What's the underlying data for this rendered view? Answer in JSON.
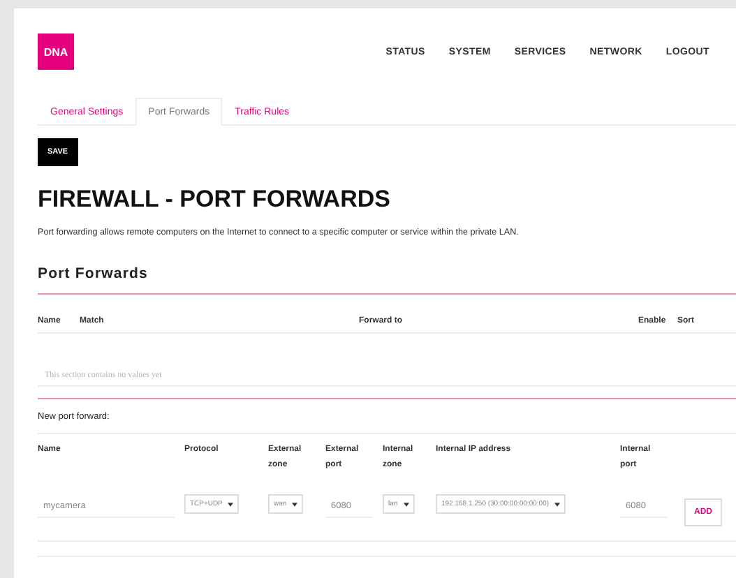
{
  "logo": "DNA",
  "nav": [
    "STATUS",
    "SYSTEM",
    "SERVICES",
    "NETWORK",
    "LOGOUT"
  ],
  "tabs": [
    {
      "label": "General Settings",
      "selected": false
    },
    {
      "label": "Port Forwards",
      "selected": true
    },
    {
      "label": "Traffic Rules",
      "selected": false
    }
  ],
  "save_button": "SAVE",
  "title": "FIREWALL - PORT FORWARDS",
  "description": "Port forwarding allows remote computers on the Internet to connect to a specific computer or service within the private LAN.",
  "section_title": "Port Forwards",
  "table": {
    "columns": [
      "Name",
      "Match",
      "Forward to",
      "Enable",
      "Sort"
    ],
    "empty_message": "This section contains no values yet"
  },
  "new_forward": {
    "label": "New port forward:",
    "columns": [
      [
        "Name"
      ],
      [
        "Protocol"
      ],
      [
        "External",
        "zone"
      ],
      [
        "External",
        "port"
      ],
      [
        "Internal",
        "zone"
      ],
      [
        "Internal IP address"
      ],
      [
        "Internal",
        "port"
      ]
    ],
    "fields": [
      {
        "kind": "text",
        "value": "mycamera"
      },
      {
        "kind": "select",
        "value": "TCP+UDP"
      },
      {
        "kind": "select",
        "value": "wan"
      },
      {
        "kind": "text",
        "value": "6080"
      },
      {
        "kind": "select",
        "value": "lan"
      },
      {
        "kind": "select",
        "value": "192.168.1.250 (30:00:00:00:00:00)"
      },
      {
        "kind": "text",
        "value": "6080"
      }
    ],
    "add_button": "ADD"
  }
}
